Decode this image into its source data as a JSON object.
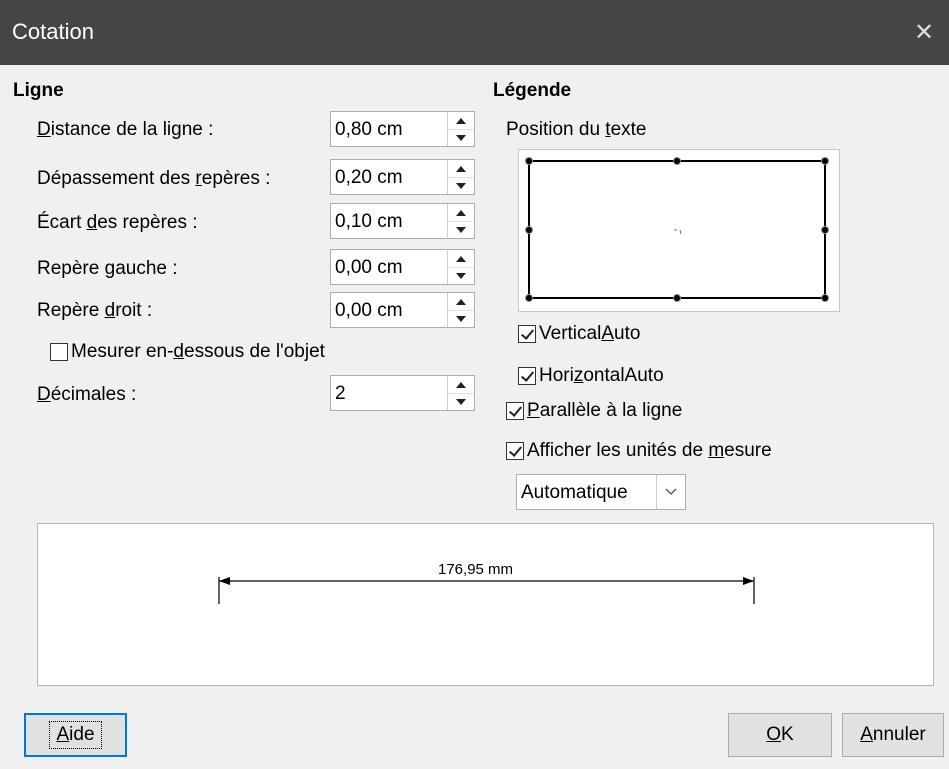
{
  "title": "Cotation",
  "ligne": {
    "heading": "Ligne",
    "fields": [
      {
        "pre": "",
        "u": "D",
        "post": "istance de la ligne :",
        "value": "0,80 cm"
      },
      {
        "pre": "Dépassement des ",
        "u": "r",
        "post": "epères :",
        "value": "0,20 cm"
      },
      {
        "pre": "Écart ",
        "u": "d",
        "post": "es repères :",
        "value": "0,10 cm"
      },
      {
        "pre": "Repère ",
        "u": "g",
        "post": "auche :",
        "value": "0,00 cm"
      },
      {
        "pre": "Repère ",
        "u": "d",
        "post": "roit :",
        "value": "0,00 cm"
      }
    ],
    "measure_below": {
      "pre": "Mesurer en-",
      "u": "d",
      "post": "essous de l'objet",
      "checked": false
    },
    "decimals": {
      "pre": "",
      "u": "D",
      "post": "écimales :",
      "value": "2"
    }
  },
  "legende": {
    "heading": "Légende",
    "position_label": {
      "pre": "Position du ",
      "u": "t",
      "post": "exte"
    },
    "vertical_auto": {
      "pre": "Vertical",
      "u": "A",
      "post": "uto",
      "checked": true
    },
    "horizontal_auto": {
      "pre": "Hori",
      "u": "z",
      "post": "ontalAuto",
      "checked": true
    },
    "parallel": {
      "pre": "",
      "u": "P",
      "post": "arallèle à la ligne",
      "checked": true
    },
    "show_units": {
      "pre": "Afficher les unités de ",
      "u": "m",
      "post": "esure",
      "checked": true
    },
    "unit_select": "Automatique"
  },
  "preview": {
    "measure_text": "176,95 mm"
  },
  "buttons": {
    "help": {
      "pre": "",
      "u": "A",
      "post": "ide"
    },
    "ok": {
      "pre": "",
      "u": "O",
      "post": "K"
    },
    "cancel": {
      "pre": "",
      "u": "A",
      "post": "nnuler"
    }
  }
}
